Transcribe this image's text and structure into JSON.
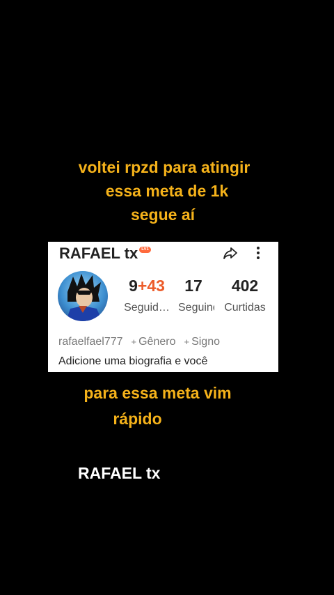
{
  "captions": {
    "top_lines": [
      "voltei rpzd para atingir",
      "essa meta de 1k",
      "segue aí"
    ],
    "middle_lines": [
      "para essa meta vim",
      "rápido"
    ],
    "signature": "RAFAEL tx"
  },
  "profile": {
    "name": "RAFAEL tx",
    "level_badge": "LV1",
    "followers": {
      "base": "9",
      "delta": "+43",
      "label": "Seguid…"
    },
    "following": {
      "value": "17",
      "label": "Seguindo"
    },
    "likes": {
      "value": "402",
      "label": "Curtidas"
    },
    "handle": "rafaelfael777",
    "tags": [
      "Gênero",
      "Signo"
    ],
    "bio": "Adicione uma biografia e você"
  },
  "colors": {
    "caption": "#f5b21a",
    "accent_delta": "#ec5c2a",
    "background": "#000000",
    "card": "#ffffff"
  },
  "icons": [
    "share-icon",
    "more-icon"
  ]
}
